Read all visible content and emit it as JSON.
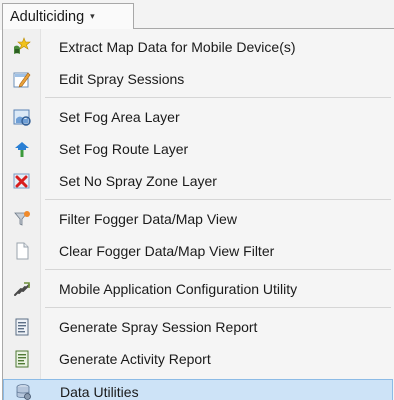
{
  "menu": {
    "title": "Adulticiding",
    "caret": "▾"
  },
  "items": [
    {
      "label": "Extract Map Data for Mobile Device(s)",
      "icon": "extract-map-icon"
    },
    {
      "label": "Edit Spray Sessions",
      "icon": "edit-sessions-icon"
    },
    {
      "label": "Set Fog Area Layer",
      "icon": "fog-area-icon"
    },
    {
      "label": "Set Fog Route Layer",
      "icon": "fog-route-icon"
    },
    {
      "label": "Set No Spray Zone Layer",
      "icon": "no-spray-icon"
    },
    {
      "label": "Filter Fogger Data/Map View",
      "icon": "filter-icon"
    },
    {
      "label": "Clear Fogger Data/Map View Filter",
      "icon": "clear-filter-icon"
    },
    {
      "label": "Mobile Application Configuration Utility",
      "icon": "config-utility-icon"
    },
    {
      "label": "Generate Spray Session Report",
      "icon": "session-report-icon"
    },
    {
      "label": "Generate Activity Report",
      "icon": "activity-report-icon"
    },
    {
      "label": "Data Utilities",
      "icon": "data-utilities-icon",
      "selected": true
    }
  ],
  "colors": {
    "selection_bg": "#cde3f7",
    "selection_border": "#8cbbe6",
    "menu_bg": "#f5f5f5"
  }
}
